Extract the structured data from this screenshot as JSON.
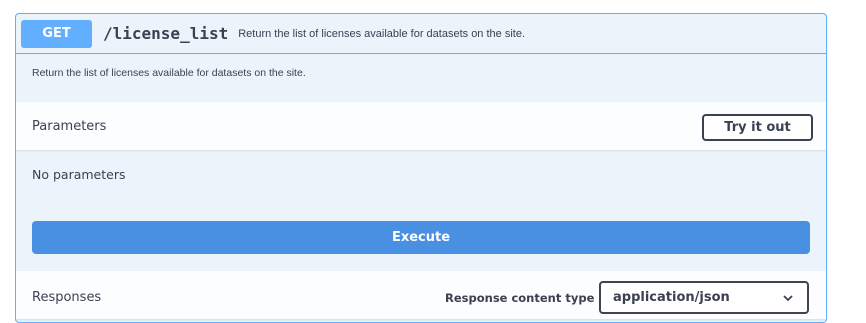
{
  "operation": {
    "method": "GET",
    "path": "/license_list",
    "summary": "Return the list of licenses available for datasets on the site.",
    "description": "Return the list of licenses available for datasets on the site."
  },
  "parameters": {
    "title": "Parameters",
    "try_it_out_label": "Try it out",
    "empty_text": "No parameters"
  },
  "execute_label": "Execute",
  "responses": {
    "title": "Responses",
    "content_type_label": "Response content type",
    "content_type_value": "application/json"
  },
  "colors": {
    "get_accent": "#61affe",
    "execute": "#4990e2",
    "panel_bg": "#ebf3fb",
    "text": "#3b4151"
  },
  "icons": {
    "select_arrow": "chevron-down-icon"
  }
}
